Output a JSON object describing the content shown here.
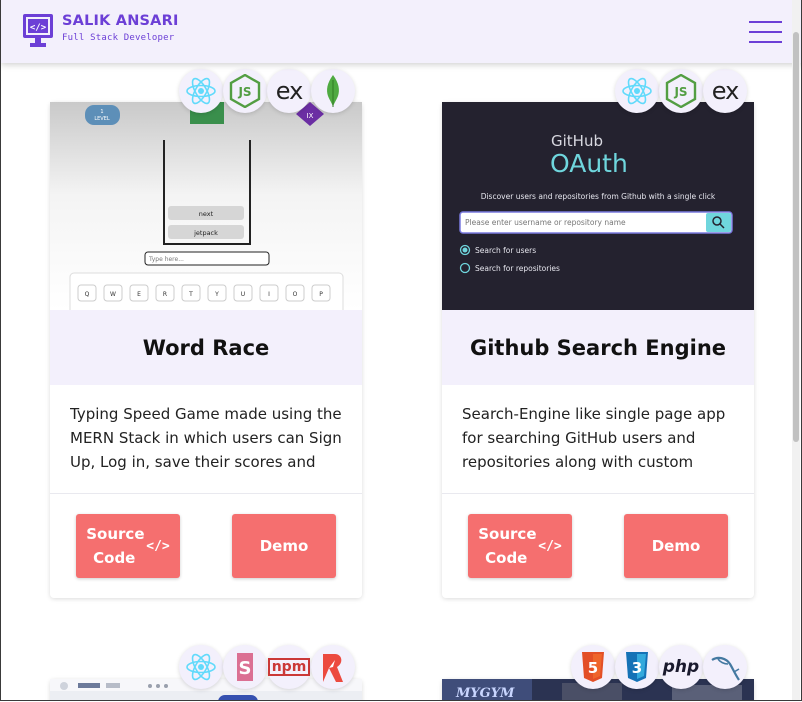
{
  "header": {
    "brand_name": "SALIK ANSARI",
    "brand_subtitle": "Full Stack Developer",
    "logo_icon": "code-monitor-icon",
    "menu_icon": "hamburger-menu-icon",
    "accent_color": "#6c3fd6"
  },
  "projects": [
    {
      "title": "Word Race",
      "description": "Typing Speed Game made using the MERN Stack in which users can Sign Up, Log in, save their scores and see…",
      "source_label": "Source Code",
      "source_icon": "</>",
      "demo_label": "Demo",
      "tech": [
        "react-icon",
        "nodejs-icon",
        "express-icon",
        "mongodb-icon"
      ],
      "screenshot": {
        "level_label": "LEVEL",
        "level_number": "1",
        "words": [
          "next",
          "jetpack"
        ],
        "input_placeholder": "Type here...",
        "keys": [
          "Q",
          "W",
          "E",
          "R",
          "T",
          "Y",
          "U",
          "I",
          "O",
          "P"
        ]
      }
    },
    {
      "title": "Github Search Engine",
      "description": "Search-Engine like single page app for searching GitHub users and repositories along with custom lazy…",
      "source_label": "Source Code",
      "source_icon": "</>",
      "demo_label": "Demo",
      "tech": [
        "react-icon",
        "nodejs-icon",
        "express-icon"
      ],
      "screenshot": {
        "heading_small": "GitHub",
        "heading_large": "OAuth",
        "tagline": "Discover users and repositories from Github with a single click",
        "input_placeholder": "Please enter username or repository name",
        "radio_users": "Search for users",
        "radio_repos": "Search for repositories"
      }
    },
    {
      "tech": [
        "react-icon",
        "styled-components-icon",
        "npm-icon",
        "rollup-icon"
      ]
    },
    {
      "tech": [
        "html5-icon",
        "css3-icon",
        "php-icon",
        "mysql-icon"
      ]
    }
  ],
  "badge_text": {
    "express": "ex",
    "npm": "npm",
    "php": "php",
    "html5": "5",
    "css3": "3"
  },
  "colors": {
    "band": "#f3f0fc",
    "button": "#f56f6f",
    "github_bg": "#24222f",
    "github_accent": "#6fd6dd"
  }
}
